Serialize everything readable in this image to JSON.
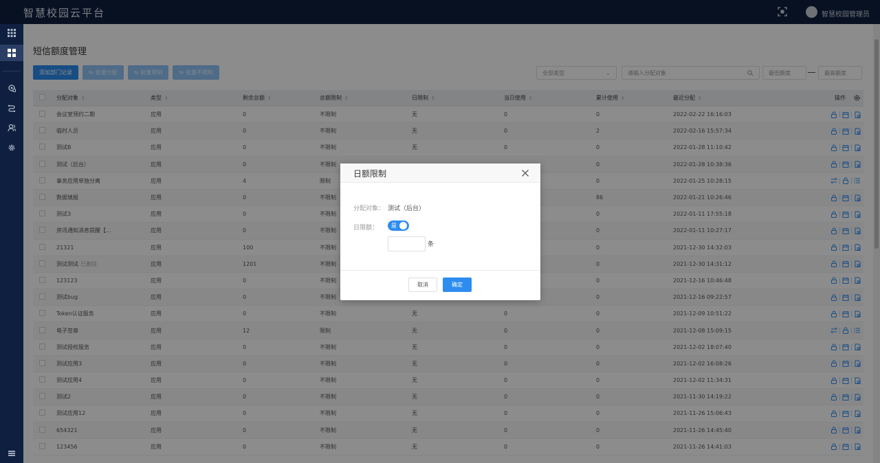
{
  "app": {
    "title": "智慧校园云平台",
    "user": "智慧校园管理员"
  },
  "page": {
    "title": "短信额度管理"
  },
  "toolbar": {
    "add": "添加部门记录",
    "batch_assign": "批量分配",
    "batch_limit": "批量限制",
    "batch_unlimit": "批量不限制"
  },
  "filters": {
    "type_select": "全部类型",
    "search_placeholder": "请输入分配对象",
    "min_placeholder": "最低额度",
    "max_placeholder": "最高额度"
  },
  "table": {
    "headers": {
      "name": "分配对象",
      "type": "类型",
      "remaining": "剩余总额",
      "total_limit": "总额限制",
      "day_limit": "日限制",
      "today_used": "当日使用",
      "accum_used": "累计使用",
      "last_assign": "最近分配",
      "ops": "操作"
    },
    "rows": [
      {
        "name": "会议室预约二期",
        "type": "应用",
        "remaining": "0",
        "total": "不限制",
        "day": "无",
        "today": "0",
        "accum": "0",
        "last": "2022-02-22 16:16:03",
        "tag": "",
        "ops": "std"
      },
      {
        "name": "临时人员",
        "type": "应用",
        "remaining": "0",
        "total": "不限制",
        "day": "无",
        "today": "0",
        "accum": "2",
        "last": "2022-02-16 15:57:34",
        "tag": "",
        "ops": "std"
      },
      {
        "name": "测试B",
        "type": "应用",
        "remaining": "0",
        "total": "不限制",
        "day": "无",
        "today": "0",
        "accum": "0",
        "last": "2022-01-28 11:10:42",
        "tag": "",
        "ops": "std"
      },
      {
        "name": "测试（后台）",
        "type": "应用",
        "remaining": "0",
        "total": "不限制",
        "day": "",
        "today": "",
        "accum": "0",
        "last": "2022-01-28 10:38:36",
        "tag": "",
        "ops": "std"
      },
      {
        "name": "事务应用单独分离",
        "type": "应用",
        "remaining": "4",
        "total": "限制",
        "day": "",
        "today": "",
        "accum": "0",
        "last": "2022-01-25 10:28:15",
        "tag": "",
        "ops": "alt"
      },
      {
        "name": "数据填报",
        "type": "应用",
        "remaining": "0",
        "total": "不限制",
        "day": "",
        "today": "",
        "accum": "86",
        "last": "2022-01-21 10:26:46",
        "tag": "",
        "ops": "std"
      },
      {
        "name": "测试3",
        "type": "应用",
        "remaining": "0",
        "total": "不限制",
        "day": "",
        "today": "",
        "accum": "0",
        "last": "2022-01-11 17:55:18",
        "tag": "",
        "ops": "std"
      },
      {
        "name": "资讯通知消息提醒【...",
        "type": "应用",
        "remaining": "0",
        "total": "不限制",
        "day": "",
        "today": "",
        "accum": "0",
        "last": "2022-01-11 10:27:17",
        "tag": "",
        "ops": "std"
      },
      {
        "name": "21321",
        "type": "应用",
        "remaining": "100",
        "total": "不限制",
        "day": "",
        "today": "",
        "accum": "0",
        "last": "2021-12-30 14:32:03",
        "tag": "",
        "ops": "std"
      },
      {
        "name": "测试测试",
        "type": "应用",
        "remaining": "1201",
        "total": "不限制",
        "day": "",
        "today": "",
        "accum": "0",
        "last": "2021-12-30 14:31:12",
        "tag": "已删除",
        "ops": "std"
      },
      {
        "name": "123123",
        "type": "应用",
        "remaining": "0",
        "total": "不限制",
        "day": "",
        "today": "",
        "accum": "0",
        "last": "2021-12-16 10:46:48",
        "tag": "",
        "ops": "std"
      },
      {
        "name": "测试bug",
        "type": "应用",
        "remaining": "0",
        "total": "不限制",
        "day": "无",
        "today": "0",
        "accum": "0",
        "last": "2021-12-16 09:22:57",
        "tag": "",
        "ops": "std"
      },
      {
        "name": "Token认证服务",
        "type": "应用",
        "remaining": "0",
        "total": "不限制",
        "day": "无",
        "today": "0",
        "accum": "0",
        "last": "2021-12-09 10:51:22",
        "tag": "",
        "ops": "std"
      },
      {
        "name": "电子签章",
        "type": "应用",
        "remaining": "12",
        "total": "限制",
        "day": "无",
        "today": "0",
        "accum": "0",
        "last": "2021-12-08 15:09:15",
        "tag": "",
        "ops": "alt"
      },
      {
        "name": "测试授权服务",
        "type": "应用",
        "remaining": "0",
        "total": "不限制",
        "day": "无",
        "today": "0",
        "accum": "0",
        "last": "2021-12-02 18:07:40",
        "tag": "",
        "ops": "std"
      },
      {
        "name": "测试应用3",
        "type": "应用",
        "remaining": "0",
        "total": "不限制",
        "day": "无",
        "today": "0",
        "accum": "0",
        "last": "2021-12-02 16:08:26",
        "tag": "",
        "ops": "std"
      },
      {
        "name": "测试应用4",
        "type": "应用",
        "remaining": "0",
        "total": "不限制",
        "day": "无",
        "today": "0",
        "accum": "0",
        "last": "2021-12-02 11:34:31",
        "tag": "",
        "ops": "std"
      },
      {
        "name": "测试2",
        "type": "应用",
        "remaining": "0",
        "total": "不限制",
        "day": "无",
        "today": "0",
        "accum": "0",
        "last": "2021-11-30 14:19:22",
        "tag": "",
        "ops": "std"
      },
      {
        "name": "测试应用12",
        "type": "应用",
        "remaining": "0",
        "total": "不限制",
        "day": "无",
        "today": "0",
        "accum": "0",
        "last": "2021-11-26 15:06:43",
        "tag": "",
        "ops": "std"
      },
      {
        "name": "654321",
        "type": "应用",
        "remaining": "0",
        "total": "不限制",
        "day": "无",
        "today": "0",
        "accum": "0",
        "last": "2021-11-26 14:45:40",
        "tag": "",
        "ops": "std"
      },
      {
        "name": "123456",
        "type": "应用",
        "remaining": "0",
        "total": "不限制",
        "day": "无",
        "today": "0",
        "accum": "0",
        "last": "2021-11-26 14:41:03",
        "tag": "",
        "ops": "std"
      }
    ]
  },
  "modal": {
    "title": "日额限制",
    "target_label": "分配对象：",
    "target_value": "测试（后台）",
    "daily_label": "日限额：",
    "switch_text": "是",
    "unit": "条",
    "cancel": "取消",
    "ok": "确定"
  },
  "colors": {
    "primary": "#2d8cf0",
    "nav": "#0f1f3f"
  }
}
